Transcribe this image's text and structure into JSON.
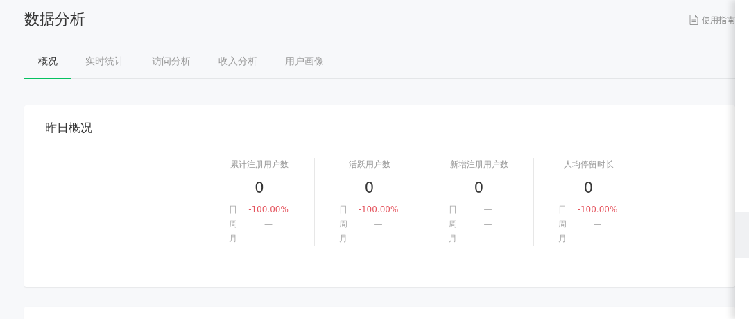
{
  "header": {
    "title": "数据分析",
    "guide_link": "使用指南"
  },
  "tabs": [
    {
      "label": "概况",
      "selected": true
    },
    {
      "label": "实时统计",
      "selected": false
    },
    {
      "label": "访问分析",
      "selected": false
    },
    {
      "label": "收入分析",
      "selected": false
    },
    {
      "label": "用户画像",
      "selected": false
    }
  ],
  "yesterday_card": {
    "title": "昨日概况",
    "stats": [
      {
        "label": "累计注册用户数",
        "value": "0",
        "compare": [
          {
            "period": "日",
            "change": "-100.00%",
            "kind": "down"
          },
          {
            "period": "周",
            "change": "—",
            "kind": "flat"
          },
          {
            "period": "月",
            "change": "—",
            "kind": "flat"
          }
        ]
      },
      {
        "label": "活跃用户数",
        "value": "0",
        "compare": [
          {
            "period": "日",
            "change": "-100.00%",
            "kind": "down"
          },
          {
            "period": "周",
            "change": "—",
            "kind": "flat"
          },
          {
            "period": "月",
            "change": "—",
            "kind": "flat"
          }
        ]
      },
      {
        "label": "新增注册用户数",
        "value": "0",
        "compare": [
          {
            "period": "日",
            "change": "—",
            "kind": "flat"
          },
          {
            "period": "周",
            "change": "—",
            "kind": "flat"
          },
          {
            "period": "月",
            "change": "—",
            "kind": "flat"
          }
        ]
      },
      {
        "label": "人均停留时长",
        "value": "0",
        "compare": [
          {
            "period": "日",
            "change": "-100.00%",
            "kind": "down"
          },
          {
            "period": "周",
            "change": "—",
            "kind": "flat"
          },
          {
            "period": "月",
            "change": "—",
            "kind": "flat"
          }
        ]
      }
    ]
  }
}
